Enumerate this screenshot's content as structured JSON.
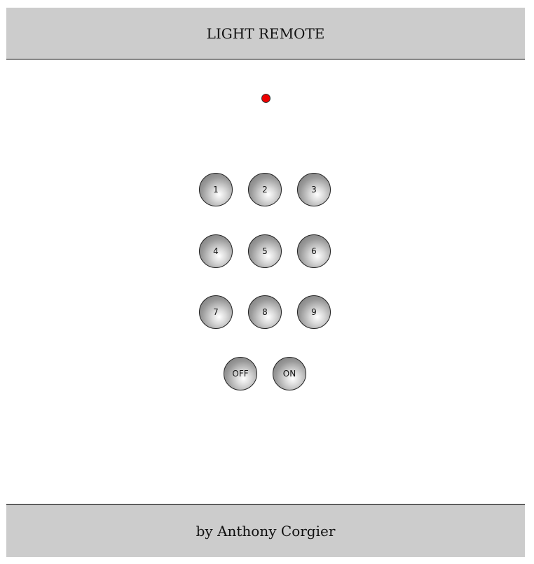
{
  "header": {
    "title": "LIGHT REMOTE"
  },
  "status": {
    "indicator_color": "#ee0000"
  },
  "keypad": {
    "rows": [
      [
        "1",
        "2",
        "3"
      ],
      [
        "4",
        "5",
        "6"
      ],
      [
        "7",
        "8",
        "9"
      ]
    ],
    "power": {
      "off_label": "OFF",
      "on_label": "ON"
    }
  },
  "footer": {
    "credit": "by Anthony Corgier"
  }
}
